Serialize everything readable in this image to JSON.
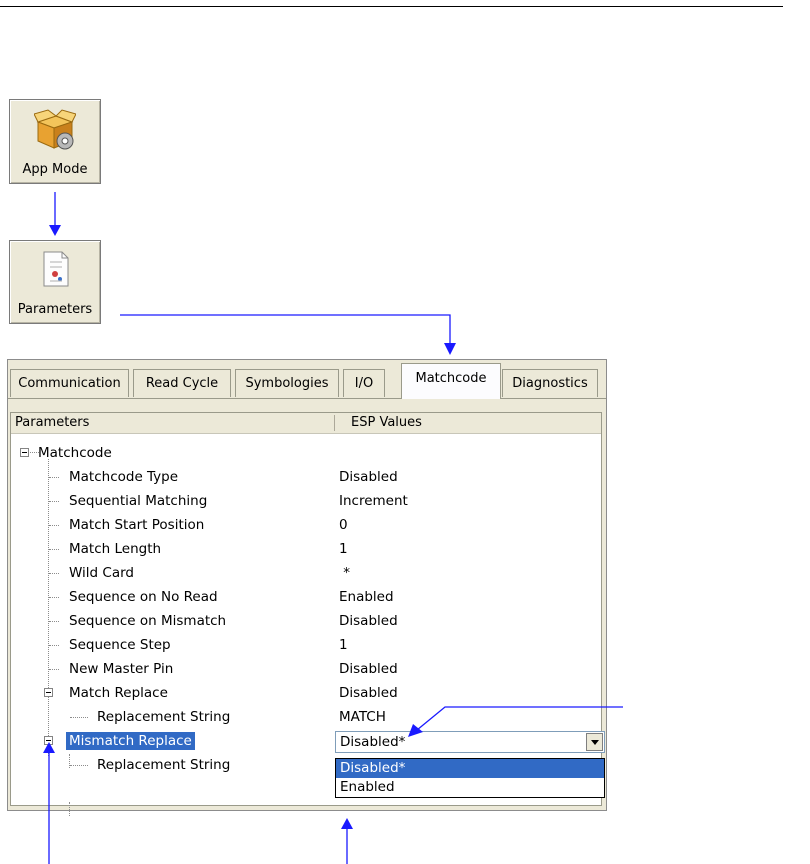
{
  "toolbar": {
    "app_mode_label": "App Mode",
    "parameters_label": "Parameters",
    "app_mode_icon": "app-mode-box-gear-icon",
    "parameters_icon": "parameters-document-icon"
  },
  "tabs": [
    {
      "label": "Communication"
    },
    {
      "label": "Read Cycle"
    },
    {
      "label": "Symbologies"
    },
    {
      "label": "I/O"
    },
    {
      "label": "Matchcode",
      "active": true
    },
    {
      "label": "Diagnostics"
    }
  ],
  "columns": {
    "parameters": "Parameters",
    "values": "ESP Values"
  },
  "tree": {
    "root": "Matchcode",
    "rows": [
      {
        "label": "Matchcode Type",
        "value": "Disabled"
      },
      {
        "label": "Sequential Matching",
        "value": "Increment"
      },
      {
        "label": "Match Start Position",
        "value": "0"
      },
      {
        "label": "Match Length",
        "value": "1"
      },
      {
        "label": "Wild Card",
        "value": " *"
      },
      {
        "label": "Sequence on No Read",
        "value": "Enabled"
      },
      {
        "label": "Sequence on Mismatch",
        "value": "Disabled"
      },
      {
        "label": "Sequence Step",
        "value": "1"
      },
      {
        "label": "New Master Pin",
        "value": "Disabled"
      },
      {
        "label": "Match Replace",
        "value": "Disabled"
      },
      {
        "label": "Replacement String",
        "value": "MATCH"
      },
      {
        "label": "Mismatch Replace",
        "value": ""
      },
      {
        "label": "Replacement String",
        "value": ""
      }
    ]
  },
  "dropdown": {
    "current": "Disabled*",
    "options": [
      "Disabled*",
      "Enabled"
    ],
    "highlighted_index": 0
  },
  "colors": {
    "selection": "#316ac5",
    "arrow": "#1a1aff",
    "panel_bg": "#ece9d8"
  }
}
